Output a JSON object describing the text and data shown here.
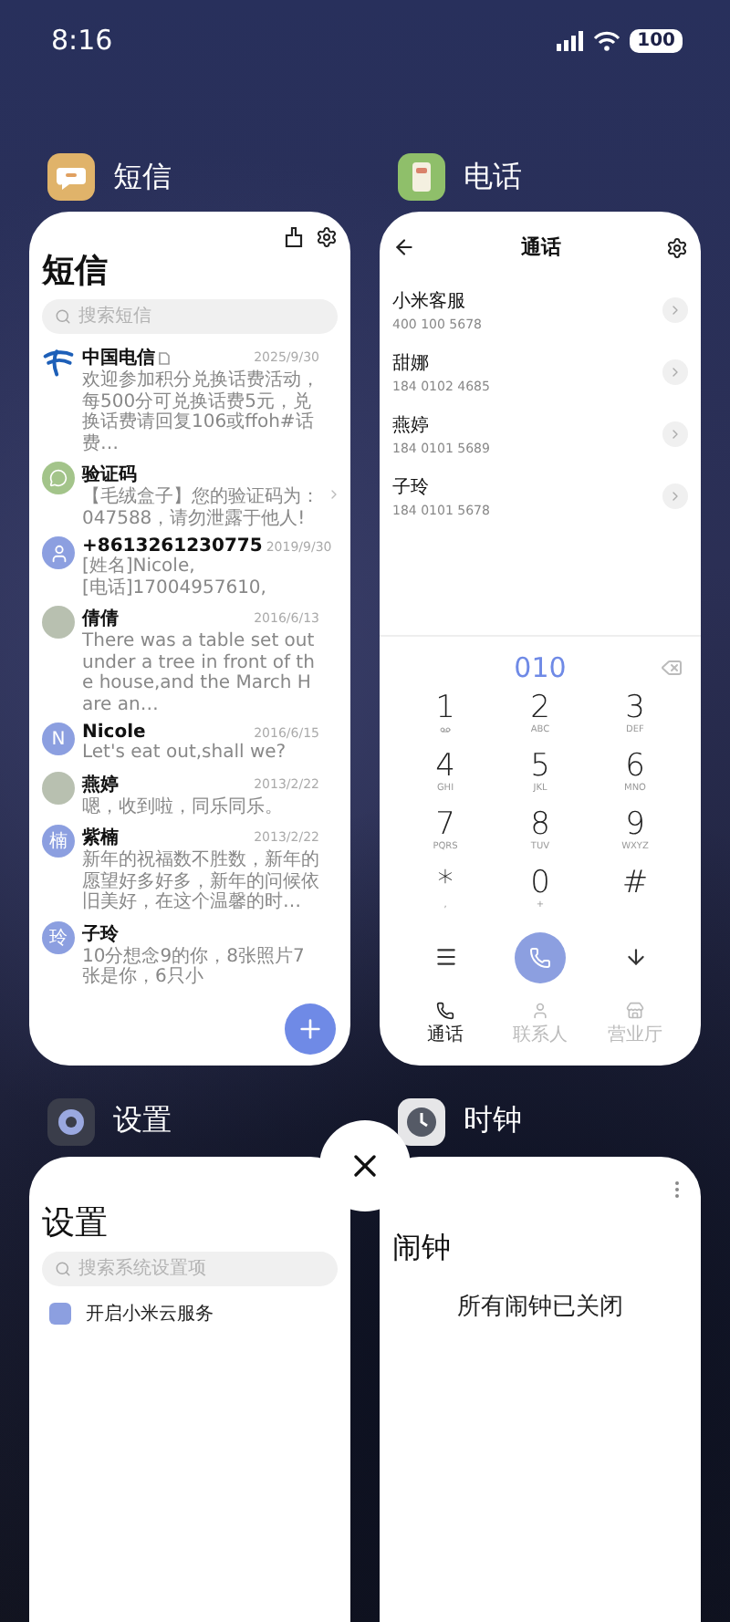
{
  "status_bar": {
    "time": "8:16",
    "battery": "100"
  },
  "apps": [
    {
      "kind": "messages",
      "name": "短信",
      "screen": {
        "title": "短信",
        "search_placeholder": "搜索短信",
        "threads": [
          {
            "kind": "logo",
            "sender": "中国电信",
            "sim_tag": true,
            "date": "2025/9/30",
            "preview": "欢迎参加积分兑换话费活动，每500分可兑换话费5元，兑换话费请回复106或ffoh#话费…",
            "arrow": false
          },
          {
            "kind": "bubble",
            "sender": "验证码",
            "sim_tag": false,
            "preview": "【毛绒盒子】您的验证码为：047588，请勿泄露于他人!",
            "arrow": true
          },
          {
            "kind": "person",
            "sender": "+8613261230775",
            "sim_tag": false,
            "date": "2019/9/30",
            "preview": "[姓名]Nicole,\n[电话]17004957610,",
            "arrow": false
          },
          {
            "kind": "photo",
            "sender": "倩倩",
            "sim_tag": false,
            "date": "2016/6/13",
            "preview": "There was a table set out under a tree in front of the house,and the March Hare an…",
            "arrow": false
          },
          {
            "kind": "letter",
            "letter": "N",
            "sender": "Nicole",
            "sim_tag": false,
            "date": "2016/6/15",
            "preview": "Let's eat out,shall we?",
            "arrow": false
          },
          {
            "kind": "photo",
            "sender": "燕婷",
            "sim_tag": false,
            "date": "2013/2/22",
            "preview": "嗯，收到啦，同乐同乐。",
            "arrow": false
          },
          {
            "kind": "letter",
            "letter": "楠",
            "sender": "紫楠",
            "sim_tag": false,
            "date": "2013/2/22",
            "preview": "新年的祝福数不胜数，新年的愿望好多好多，新年的问候依旧美好，在这个温馨的时…",
            "arrow": false
          },
          {
            "kind": "letter",
            "letter": "玲",
            "sender": "子玲",
            "sim_tag": false,
            "preview": "10分想念9的你，8张照片7张是你，6只小",
            "arrow": false
          }
        ]
      }
    },
    {
      "kind": "phone",
      "name": "电话",
      "screen": {
        "title": "通话",
        "contacts": [
          {
            "name": "小米客服",
            "number": "400 100 5678"
          },
          {
            "name": "甜娜",
            "number": "184 0102 4685"
          },
          {
            "name": "燕婷",
            "number": "184 0101 5689"
          },
          {
            "name": "子玲",
            "number": "184 0101 5678"
          }
        ],
        "dialed": "010",
        "keys": [
          {
            "digit": "1",
            "kind": "voicemail"
          },
          {
            "digit": "2",
            "kind": "letters",
            "letters": "ABC"
          },
          {
            "digit": "3",
            "kind": "letters",
            "letters": "DEF"
          },
          {
            "digit": "4",
            "kind": "letters",
            "letters": "GHI"
          },
          {
            "digit": "5",
            "kind": "letters",
            "letters": "JKL"
          },
          {
            "digit": "6",
            "kind": "letters",
            "letters": "MNO"
          },
          {
            "digit": "7",
            "kind": "letters",
            "letters": "PQRS"
          },
          {
            "digit": "8",
            "kind": "letters",
            "letters": "TUV"
          },
          {
            "digit": "9",
            "kind": "letters",
            "letters": "WXYZ"
          },
          {
            "digit": "*",
            "kind": "letters",
            "letters": ","
          },
          {
            "digit": "0",
            "kind": "letters",
            "letters": "+"
          },
          {
            "digit": "#",
            "kind": "plain"
          }
        ],
        "tabs": [
          {
            "label": "通话",
            "selected": true
          },
          {
            "label": "联系人",
            "selected": false
          },
          {
            "label": "营业厅",
            "selected": false
          }
        ]
      }
    },
    {
      "kind": "settings",
      "name": "设置",
      "screen": {
        "title": "设置",
        "search_placeholder": "搜索系统设置项",
        "items": [
          "开启小米云服务"
        ]
      }
    },
    {
      "kind": "clock",
      "name": "时钟",
      "screen": {
        "title": "闹钟",
        "empty_text": "所有闹钟已关闭"
      }
    }
  ]
}
